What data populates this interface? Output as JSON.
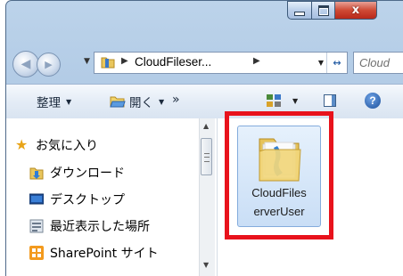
{
  "address": {
    "path_segment": "CloudFileser...",
    "search_placeholder": "Cloud"
  },
  "toolbar": {
    "organize_label": "整理",
    "open_label": "開く",
    "more_label": "»"
  },
  "nav_pane": {
    "favorites": "お気に入り",
    "items": [
      {
        "label": "ダウンロード",
        "icon": "download-folder-icon"
      },
      {
        "label": "デスクトップ",
        "icon": "desktop-icon"
      },
      {
        "label": "最近表示した場所",
        "icon": "recent-places-icon"
      },
      {
        "label": "SharePoint サイト",
        "icon": "sharepoint-icon"
      }
    ]
  },
  "content": {
    "folder_name": "CloudFileserverUser",
    "folder_label_line1": "CloudFiles",
    "folder_label_line2": "erverUser"
  },
  "colors": {
    "highlight": "#e8121c",
    "selection": "#c9def6",
    "titlebar": "#a9c4e2",
    "close_button": "#cf4a35"
  }
}
